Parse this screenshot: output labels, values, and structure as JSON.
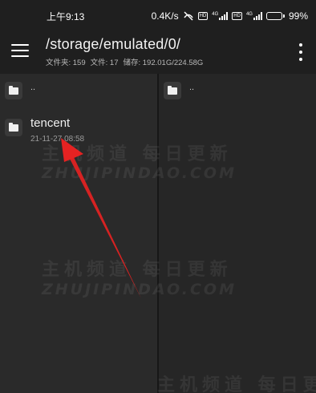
{
  "status_bar": {
    "time": "上午9:13",
    "network_speed": "0.4K/s",
    "sim1_tag": "4G",
    "sim2_tag": "4G",
    "battery_percent": "99",
    "battery_level": 0.99
  },
  "app_bar": {
    "path": "/storage/emulated/0/",
    "stats": {
      "folders": "文件夹: 159",
      "files": "文件: 17",
      "storage": "储存: 192.01G/224.58G"
    }
  },
  "left_pane": {
    "parent_label": "..",
    "entries": [
      {
        "name": "tencent",
        "date": "21-11-27 08:58"
      }
    ]
  },
  "right_pane": {
    "parent_label": ".."
  },
  "watermark": {
    "cn": "主机频道 每日更新",
    "en": "ZHUJIPINDAO.COM"
  },
  "colors": {
    "background": "#1f1f1f",
    "pane": "#2a2a2a",
    "arrow": "#e52222"
  },
  "icons": [
    "menu-icon",
    "more-vert-icon",
    "folder-icon",
    "mute-icon",
    "signal-icon",
    "battery-icon"
  ]
}
